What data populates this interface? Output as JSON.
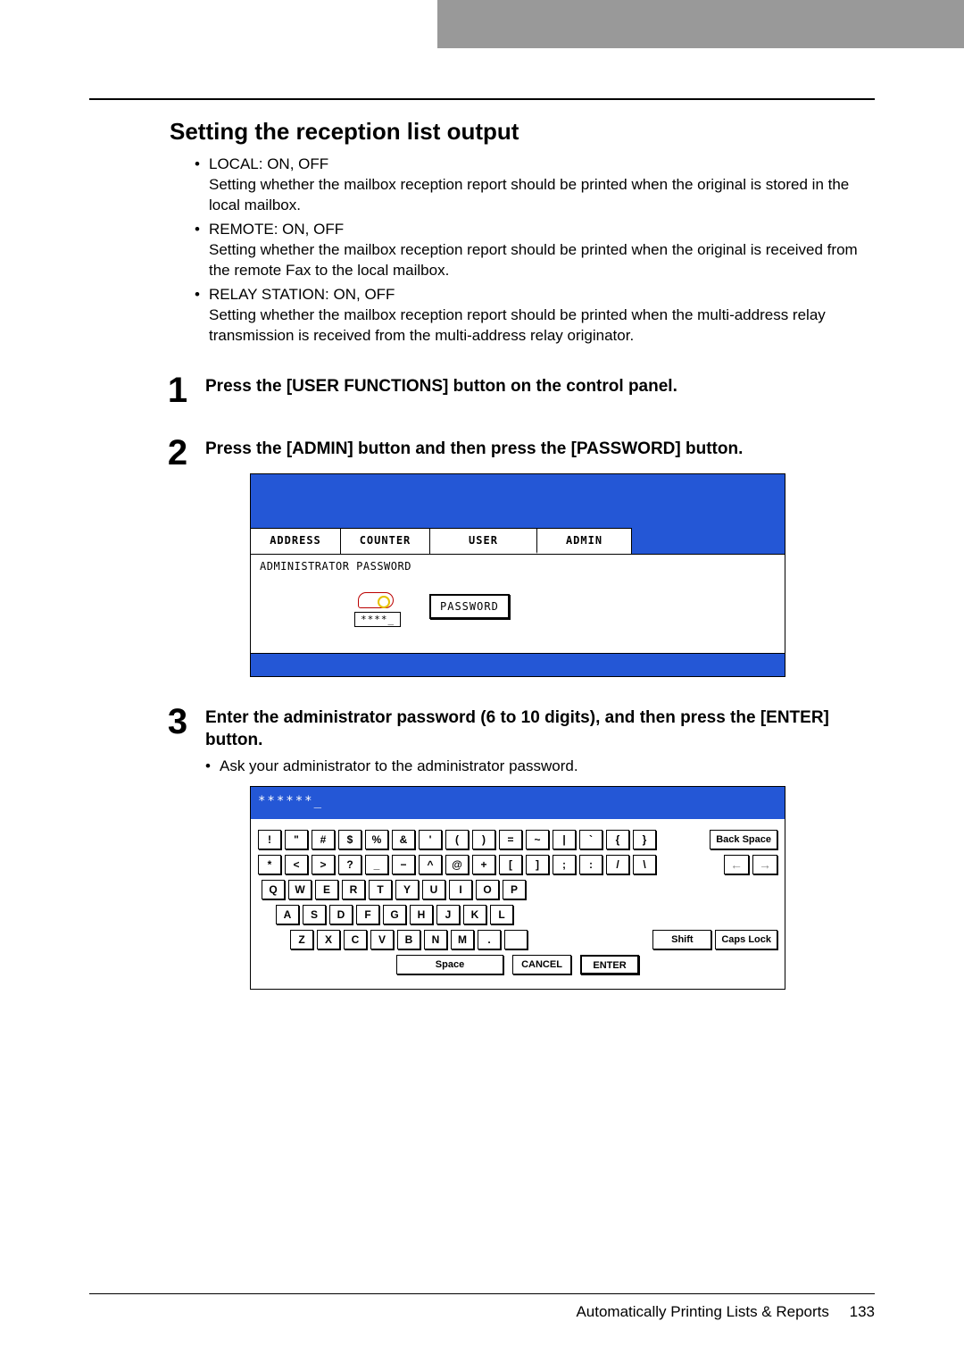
{
  "section_title": "Setting the reception list output",
  "options": [
    {
      "label": "LOCAL: ON, OFF",
      "desc": "Setting whether the mailbox reception report should be printed when the original is stored in the local mailbox."
    },
    {
      "label": "REMOTE: ON, OFF",
      "desc": "Setting whether the mailbox reception report should be printed when the original is received from the remote Fax to the local mailbox."
    },
    {
      "label": "RELAY STATION: ON, OFF",
      "desc": "Setting whether the mailbox reception report should be printed when the multi-address relay transmission is received from the multi-address relay originator."
    }
  ],
  "steps": {
    "s1": {
      "num": "1",
      "title": "Press the [USER FUNCTIONS] button on the control panel."
    },
    "s2": {
      "num": "2",
      "title": "Press the [ADMIN] button and then press the [PASSWORD] button."
    },
    "s3": {
      "num": "3",
      "title": "Enter the administrator password (6 to 10 digits), and then press the [ENTER] button.",
      "note": "Ask your administrator to the administrator password."
    }
  },
  "panel": {
    "tabs": {
      "address": "ADDRESS",
      "counter": "COUNTER",
      "user": "USER",
      "admin": "ADMIN"
    },
    "body_label": "ADMINISTRATOR PASSWORD",
    "stars": "****_",
    "password_btn": "PASSWORD"
  },
  "keyboard": {
    "input": "******_",
    "row1": [
      "!",
      "\"",
      "#",
      "$",
      "%",
      "&",
      "'",
      "(",
      ")",
      "=",
      "~",
      "|",
      "`",
      "{",
      "}"
    ],
    "row1_right": "Back Space",
    "row2": [
      "*",
      "<",
      ">",
      "?",
      "_",
      "−",
      "^",
      "@",
      "+",
      "[",
      "]",
      ";",
      ":",
      "/",
      "\\"
    ],
    "row2_arrows": [
      "←",
      "→"
    ],
    "row3": [
      "Q",
      "W",
      "E",
      "R",
      "T",
      "Y",
      "U",
      "I",
      "O",
      "P"
    ],
    "row4": [
      "A",
      "S",
      "D",
      "F",
      "G",
      "H",
      "J",
      "K",
      "L"
    ],
    "row5": [
      "Z",
      "X",
      "C",
      "V",
      "B",
      "N",
      "M",
      ".",
      " "
    ],
    "row5_right": [
      "Shift",
      "Caps Lock"
    ],
    "bottom": {
      "space": "Space",
      "cancel": "CANCEL",
      "enter": "ENTER"
    }
  },
  "footer": {
    "text": "Automatically Printing Lists & Reports",
    "page": "133"
  }
}
